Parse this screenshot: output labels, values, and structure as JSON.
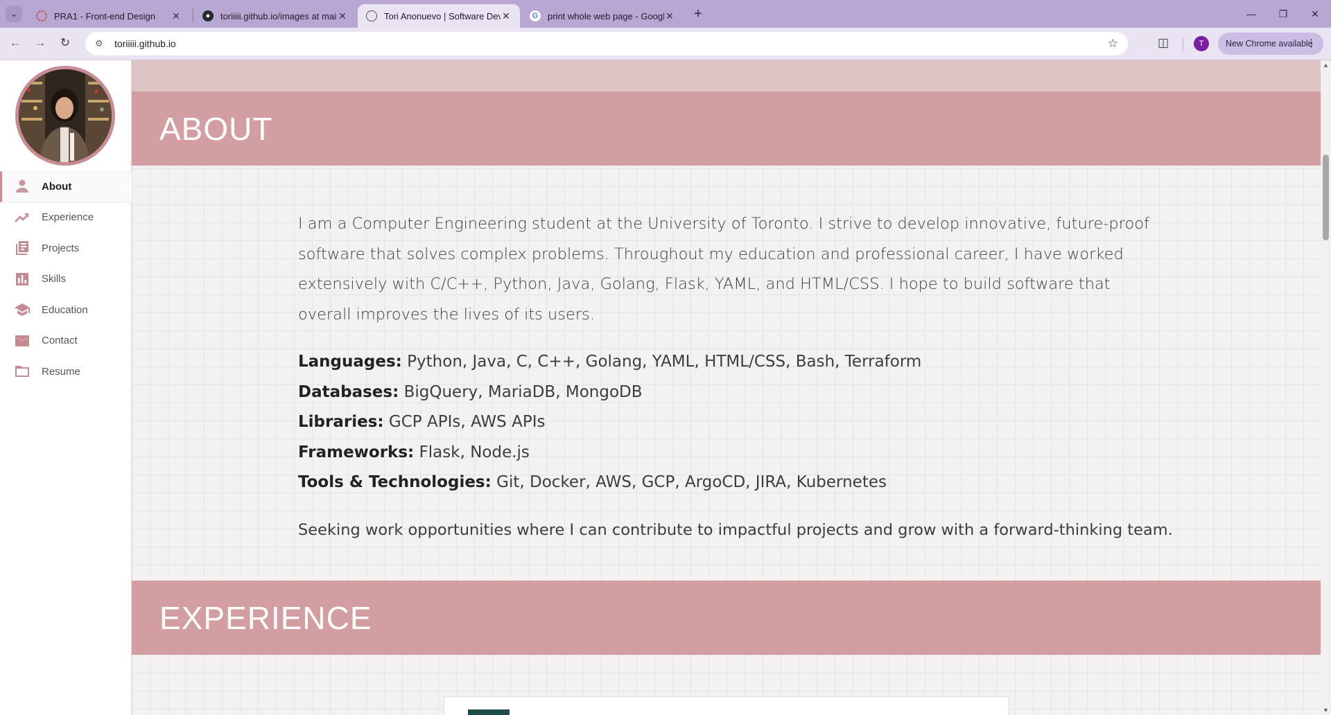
{
  "browser": {
    "tabs": [
      {
        "title": "PRA1 - Front-end Design",
        "icon": "pra1-favicon",
        "active": false
      },
      {
        "title": "toriiiii.github.io/images at main",
        "icon": "github-icon",
        "active": false
      },
      {
        "title": "Tori Anonuevo | Software Devel",
        "icon": "globe-icon",
        "active": true
      },
      {
        "title": "print whole web page - Google",
        "icon": "google-icon",
        "active": false
      }
    ],
    "url": "toriiiii.github.io",
    "profile_initial": "T",
    "update_label": "New Chrome available"
  },
  "sidebar": {
    "items": [
      {
        "label": "About",
        "icon": "person-icon",
        "active": true
      },
      {
        "label": "Experience",
        "icon": "trending-up-icon",
        "active": false
      },
      {
        "label": "Projects",
        "icon": "library-books-icon",
        "active": false
      },
      {
        "label": "Skills",
        "icon": "bar-chart-icon",
        "active": false
      },
      {
        "label": "Education",
        "icon": "school-icon",
        "active": false
      },
      {
        "label": "Contact",
        "icon": "mail-icon",
        "active": false
      },
      {
        "label": "Resume",
        "icon": "folder-icon",
        "active": false
      }
    ]
  },
  "about": {
    "heading": "ABOUT",
    "intro": "I am a Computer Engineering student at the University of Toronto. I strive to develop innovative, future-proof software that solves complex problems. Throughout my education and professional career, I have worked extensively with C/C++, Python, Java, Golang, Flask, YAML, and HTML/CSS. I hope to build software that overall improves the lives of its users.",
    "skills": [
      {
        "label": "Languages:",
        "value": "Python, Java, C, C++, Golang, YAML, HTML/CSS, Bash, Terraform"
      },
      {
        "label": "Databases:",
        "value": "BigQuery, MariaDB, MongoDB"
      },
      {
        "label": "Libraries:",
        "value": "GCP APIs, AWS APIs"
      },
      {
        "label": "Frameworks:",
        "value": "Flask, Node.js"
      },
      {
        "label": "Tools & Technologies:",
        "value": "Git, Docker, AWS, GCP, ArgoCD, JIRA, Kubernetes"
      }
    ],
    "seeking": "Seeking work opportunities where I can contribute to impactful projects and grow with a forward-thinking team."
  },
  "experience": {
    "heading": "EXPERIENCE"
  },
  "colors": {
    "accent": "#d39ea2",
    "browser_frame": "#b9a7d3",
    "sidebar_icon": "#c48b92"
  }
}
